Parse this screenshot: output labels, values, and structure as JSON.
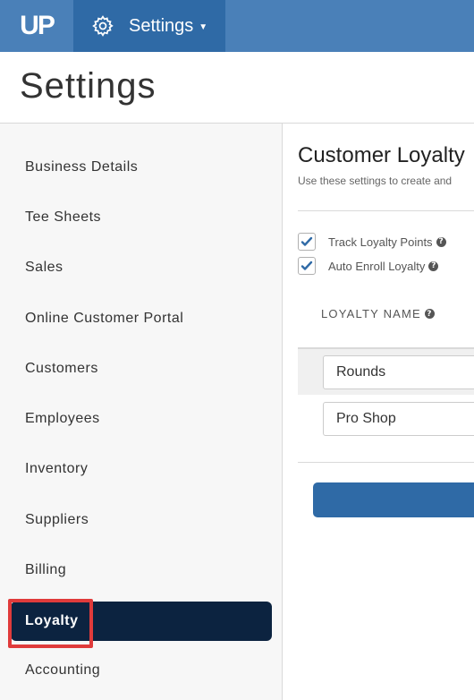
{
  "topbar": {
    "logo_text": "UP",
    "settings_label": "Settings",
    "settings_icon": "gear-icon",
    "menu_icon": "caret-down-icon",
    "bar_color": "#4a80b8",
    "active_tab_color": "#2f6aa6"
  },
  "header": {
    "title": "Settings"
  },
  "sidebar": {
    "items": [
      {
        "label": "Business Details"
      },
      {
        "label": "Tee Sheets"
      },
      {
        "label": "Sales"
      },
      {
        "label": "Online Customer Portal"
      },
      {
        "label": "Customers"
      },
      {
        "label": "Employees"
      },
      {
        "label": "Inventory"
      },
      {
        "label": "Suppliers"
      },
      {
        "label": "Billing"
      },
      {
        "label": "Loyalty"
      },
      {
        "label": "Accounting"
      }
    ],
    "active_item": "Loyalty",
    "active_color": "#0c2340",
    "highlight_color": "#e03b3b"
  },
  "content": {
    "title": "Customer Loyalty",
    "description": "Use these settings to create and",
    "options": [
      {
        "label": "Track Loyalty Points",
        "checked": true
      },
      {
        "label": "Auto Enroll Loyalty",
        "checked": true
      }
    ],
    "column_header": "LOYALTY NAME",
    "rows": [
      {
        "value": "Rounds"
      },
      {
        "value": "Pro Shop"
      }
    ],
    "button_color": "#2f6aa6",
    "check_color": "#2f6aa6"
  }
}
